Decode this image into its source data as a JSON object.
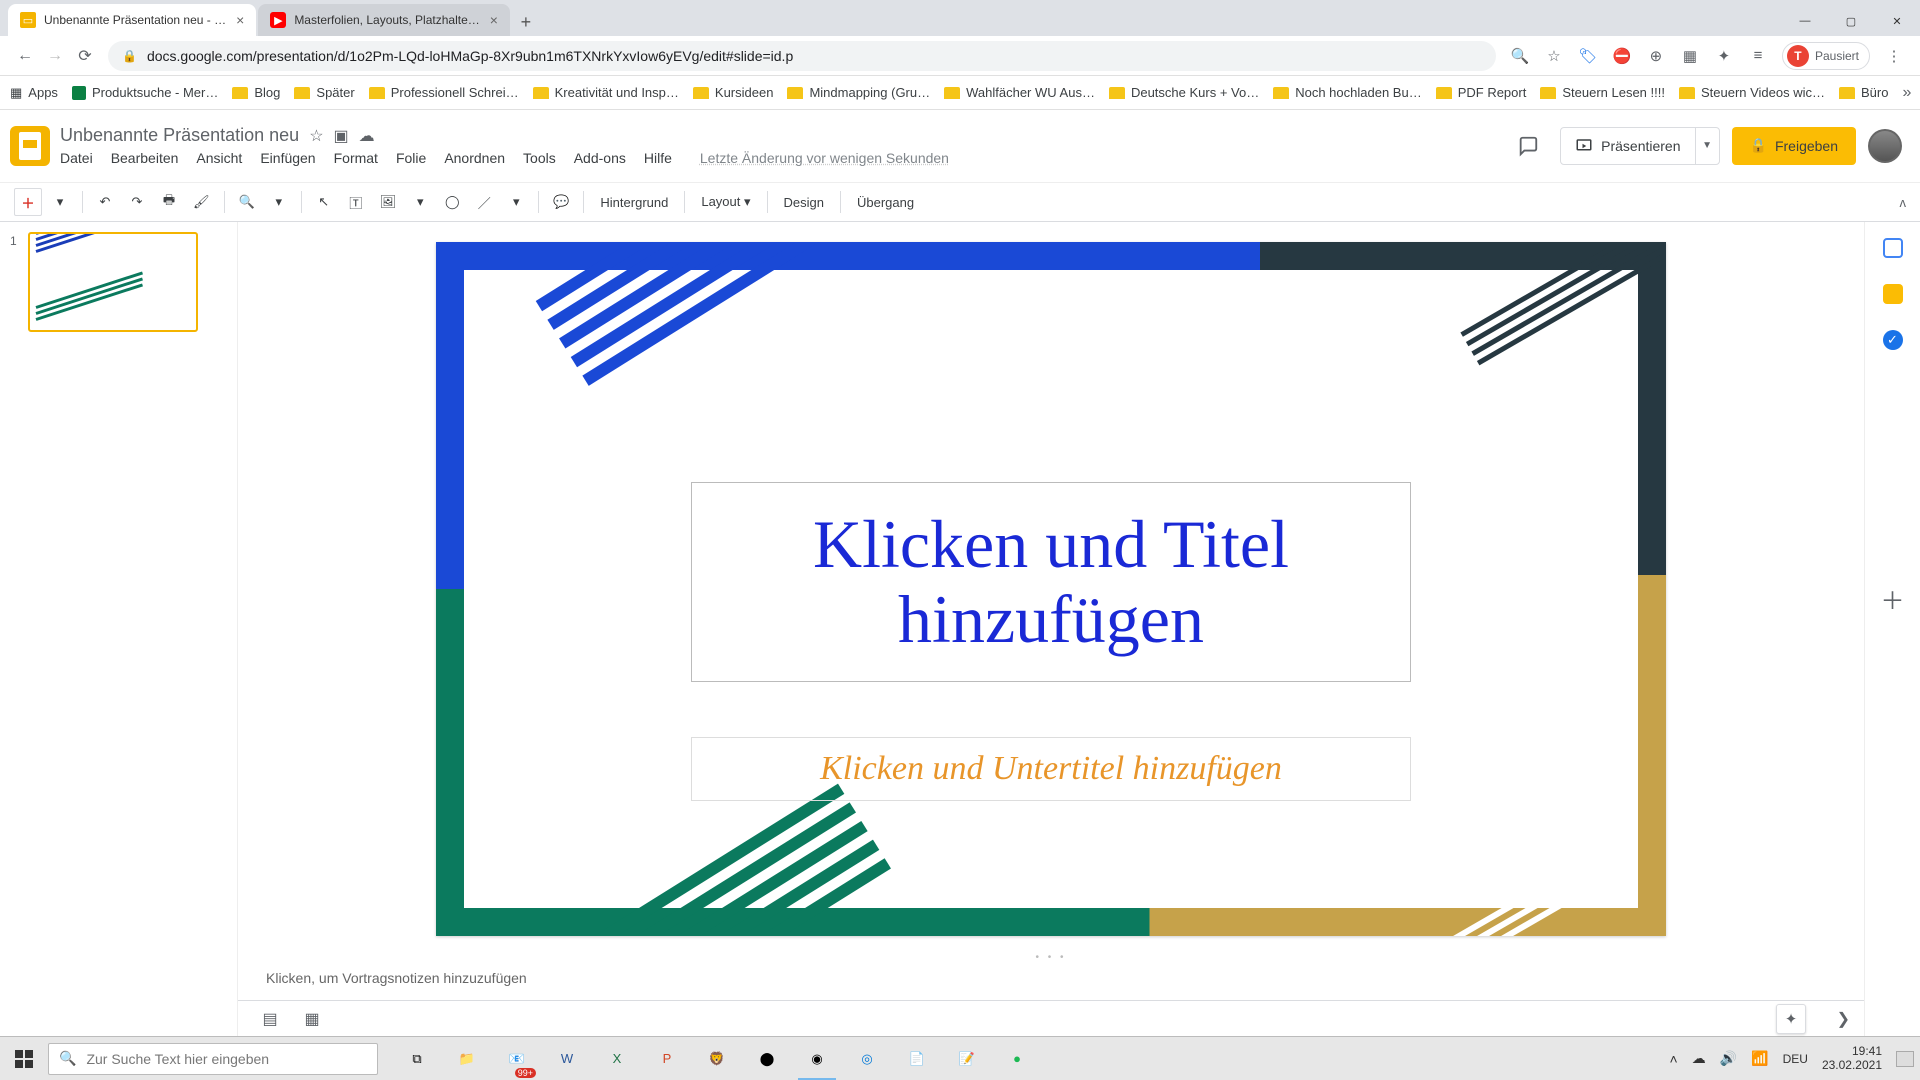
{
  "browser": {
    "tabs": [
      {
        "title": "Unbenannte Präsentation neu - …",
        "icon": "slides"
      },
      {
        "title": "Masterfolien, Layouts, Platzhalte…",
        "icon": "youtube"
      }
    ],
    "url": "docs.google.com/presentation/d/1o2Pm-LQd-loHMaGp-8Xr9ubn1m6TXNrkYxvIow6yEVg/edit#slide=id.p",
    "profile_state": "Pausiert",
    "apps_label": "Apps",
    "bookmarks": [
      "Produktsuche - Mer…",
      "Blog",
      "Später",
      "Professionell Schrei…",
      "Kreativität und Insp…",
      "Kursideen",
      "Mindmapping  (Gru…",
      "Wahlfächer WU Aus…",
      "Deutsche Kurs + Vo…",
      "Noch hochladen Bu…",
      "PDF Report",
      "Steuern Lesen !!!!",
      "Steuern Videos wic…",
      "Büro"
    ]
  },
  "app": {
    "doc_title": "Unbenannte Präsentation neu",
    "menus": [
      "Datei",
      "Bearbeiten",
      "Ansicht",
      "Einfügen",
      "Format",
      "Folie",
      "Anordnen",
      "Tools",
      "Add-ons",
      "Hilfe"
    ],
    "last_edit": "Letzte Änderung vor wenigen Sekunden",
    "present": "Präsentieren",
    "share": "Freigeben",
    "avatar_initial": "T"
  },
  "toolbar": {
    "background": "Hintergrund",
    "layout": "Layout",
    "design": "Design",
    "transition": "Übergang"
  },
  "slides": {
    "current_number": "1"
  },
  "slide_content": {
    "title_placeholder": "Klicken und Titel hinzufügen",
    "subtitle_placeholder": "Klicken und Untertitel hinzufügen"
  },
  "notes_placeholder": "Klicken, um Vortragsnotizen hinzuzufügen",
  "taskbar": {
    "search_placeholder": "Zur Suche Text hier eingeben",
    "lang": "DEU",
    "time": "19:41",
    "date": "23.02.2021",
    "badge": "99+"
  }
}
